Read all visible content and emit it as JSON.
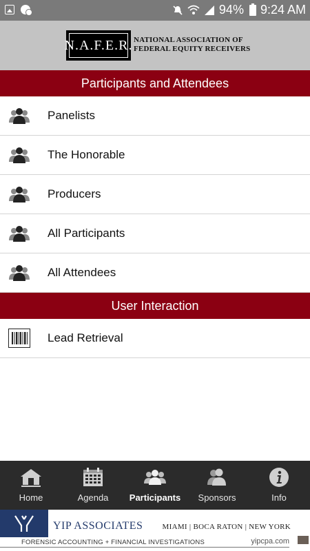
{
  "status_bar": {
    "battery": "94%",
    "time": "9:24 AM"
  },
  "header": {
    "logo_text": "N.A.F.E.R.",
    "org_line1": "NATIONAL ASSOCIATION OF",
    "org_line2": "FEDERAL EQUITY RECEIVERS"
  },
  "sections": {
    "participants_title": "Participants and Attendees",
    "interaction_title": "User Interaction"
  },
  "participants_items": [
    {
      "label": "Panelists",
      "icon": "people-icon"
    },
    {
      "label": "The Honorable",
      "icon": "people-icon"
    },
    {
      "label": "Producers",
      "icon": "people-icon"
    },
    {
      "label": "All Participants",
      "icon": "people-icon"
    },
    {
      "label": "All Attendees",
      "icon": "people-icon"
    }
  ],
  "interaction_items": [
    {
      "label": "Lead Retrieval",
      "icon": "barcode-icon"
    }
  ],
  "bottom_nav": {
    "items": [
      {
        "label": "Home",
        "icon": "home-icon"
      },
      {
        "label": "Agenda",
        "icon": "calendar-icon"
      },
      {
        "label": "Participants",
        "icon": "people-icon"
      },
      {
        "label": "Sponsors",
        "icon": "sponsors-icon"
      },
      {
        "label": "Info",
        "icon": "info-icon"
      }
    ],
    "active": "Participants"
  },
  "ad": {
    "brand": "YIP ASSOCIATES",
    "cities": "MIAMI | BOCA RATON | NEW YORK",
    "tagline": "FORENSIC ACCOUNTING + FINANCIAL INVESTIGATIONS",
    "url": "yipcpa.com"
  },
  "colors": {
    "accent": "#8b0012",
    "header_bg": "#c3c3c3",
    "nav_bg": "#2b2b2b"
  }
}
